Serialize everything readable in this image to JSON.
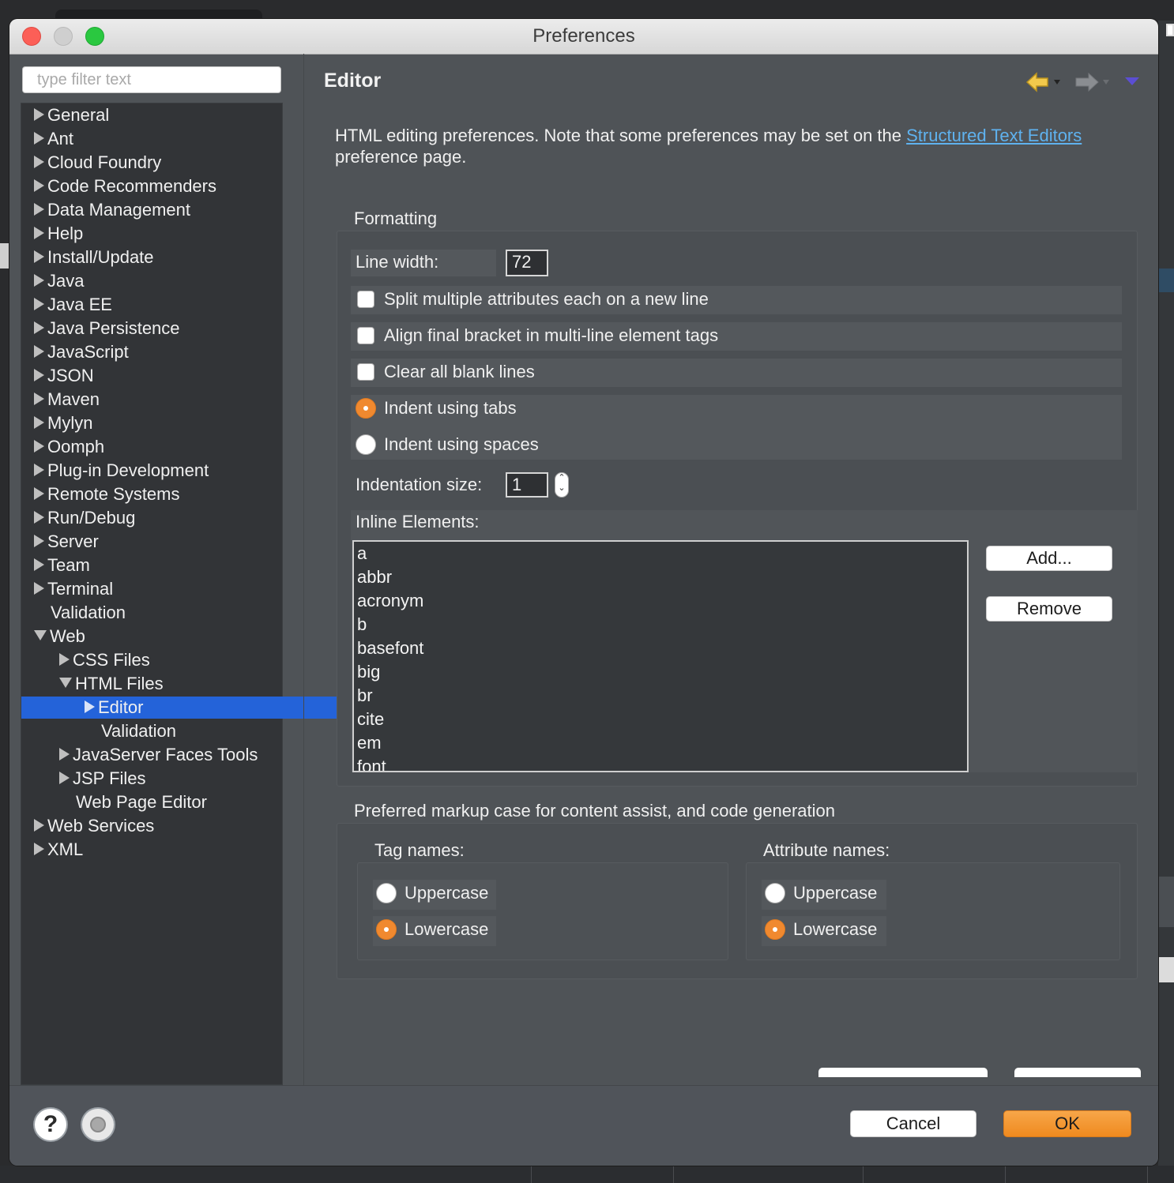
{
  "window": {
    "title": "Preferences"
  },
  "sidebar": {
    "filter_placeholder": "type filter text",
    "items": [
      {
        "label": "General",
        "arrow": "right",
        "indent": 0
      },
      {
        "label": "Ant",
        "arrow": "right",
        "indent": 0
      },
      {
        "label": "Cloud Foundry",
        "arrow": "right",
        "indent": 0
      },
      {
        "label": "Code Recommenders",
        "arrow": "right",
        "indent": 0
      },
      {
        "label": "Data Management",
        "arrow": "right",
        "indent": 0
      },
      {
        "label": "Help",
        "arrow": "right",
        "indent": 0
      },
      {
        "label": "Install/Update",
        "arrow": "right",
        "indent": 0
      },
      {
        "label": "Java",
        "arrow": "right",
        "indent": 0
      },
      {
        "label": "Java EE",
        "arrow": "right",
        "indent": 0
      },
      {
        "label": "Java Persistence",
        "arrow": "right",
        "indent": 0
      },
      {
        "label": "JavaScript",
        "arrow": "right",
        "indent": 0
      },
      {
        "label": "JSON",
        "arrow": "right",
        "indent": 0
      },
      {
        "label": "Maven",
        "arrow": "right",
        "indent": 0
      },
      {
        "label": "Mylyn",
        "arrow": "right",
        "indent": 0
      },
      {
        "label": "Oomph",
        "arrow": "right",
        "indent": 0
      },
      {
        "label": "Plug-in Development",
        "arrow": "right",
        "indent": 0
      },
      {
        "label": "Remote Systems",
        "arrow": "right",
        "indent": 0
      },
      {
        "label": "Run/Debug",
        "arrow": "right",
        "indent": 0
      },
      {
        "label": "Server",
        "arrow": "right",
        "indent": 0
      },
      {
        "label": "Team",
        "arrow": "right",
        "indent": 0
      },
      {
        "label": "Terminal",
        "arrow": "right",
        "indent": 0
      },
      {
        "label": "Validation",
        "arrow": "none",
        "indent": 0
      },
      {
        "label": "Web",
        "arrow": "down",
        "indent": 0
      },
      {
        "label": "CSS Files",
        "arrow": "right",
        "indent": 1
      },
      {
        "label": "HTML Files",
        "arrow": "down",
        "indent": 1
      },
      {
        "label": "Editor",
        "arrow": "right",
        "indent": 2,
        "selected": true
      },
      {
        "label": "Validation",
        "arrow": "none",
        "indent": 2
      },
      {
        "label": "JavaServer Faces Tools",
        "arrow": "right",
        "indent": 1
      },
      {
        "label": "JSP Files",
        "arrow": "right",
        "indent": 1
      },
      {
        "label": "Web Page Editor",
        "arrow": "none",
        "indent": 1
      },
      {
        "label": "Web Services",
        "arrow": "right",
        "indent": 0
      },
      {
        "label": "XML",
        "arrow": "right",
        "indent": 0
      }
    ]
  },
  "page": {
    "title": "Editor",
    "description_prefix": "HTML editing preferences.  Note that some preferences may be set on the ",
    "description_link": "Structured Text Editors",
    "description_suffix": " preference page."
  },
  "formatting": {
    "group_label": "Formatting",
    "line_width_label": "Line width:",
    "line_width_value": "72",
    "split_attributes_label": "Split multiple attributes each on a new line",
    "split_attributes_checked": false,
    "align_bracket_label": "Align final bracket in multi-line element tags",
    "align_bracket_checked": false,
    "clear_blank_label": "Clear all blank lines",
    "clear_blank_checked": false,
    "indent_tabs_label": "Indent using tabs",
    "indent_tabs_selected": true,
    "indent_spaces_label": "Indent using spaces",
    "indent_spaces_selected": false,
    "indent_size_label": "Indentation size:",
    "indent_size_value": "1",
    "inline_label": "Inline Elements:",
    "inline_elements": [
      "a",
      "abbr",
      "acronym",
      "b",
      "basefont",
      "big",
      "br",
      "cite",
      "em",
      "font"
    ],
    "add_label": "Add...",
    "remove_label": "Remove"
  },
  "markup_case": {
    "group_label": "Preferred markup case for content assist, and code generation",
    "tag": {
      "label": "Tag names:",
      "uppercase_label": "Uppercase",
      "lowercase_label": "Lowercase",
      "selected": "Lowercase"
    },
    "attribute": {
      "label": "Attribute names:",
      "uppercase_label": "Uppercase",
      "lowercase_label": "Lowercase",
      "selected": "Lowercase"
    }
  },
  "footer": {
    "cancel_label": "Cancel",
    "ok_label": "OK"
  },
  "colors": {
    "accent_orange": "#f0892f",
    "selection_blue": "#2463d9",
    "link_blue": "#5fb2ef"
  }
}
